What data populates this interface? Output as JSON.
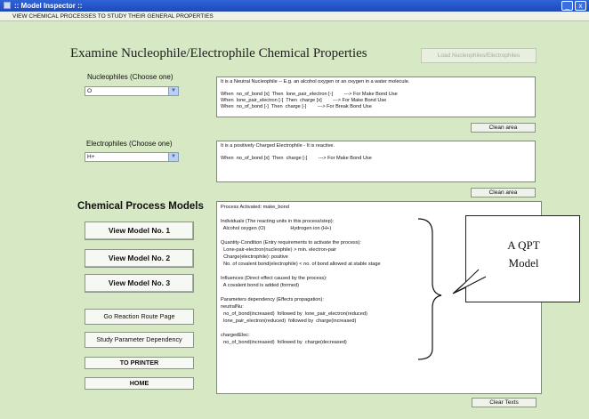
{
  "window": {
    "title": ":: Model Inspector ::",
    "menu_text": "VIEW CHEMICAL PROCESSES TO STUDY THEIR GENERAL PROPERTIES",
    "minimize_glyph": "_",
    "close_glyph": "x"
  },
  "header": {
    "heading": "Examine Nucleophile/Electrophile Chemical Properties",
    "load_button": "Load Nucleophiles/Electrophiles"
  },
  "nucleophiles": {
    "label": "Nucleophiles (Choose one)",
    "selected": "O",
    "lines": [
      "It is a Neutral Nucleophile -- E.g. an alcohol oxygen or an oxygen in a water molecule.",
      "",
      "When  no_of_bond [x]  Then  lone_pair_electron [-]        ---> For Make Bond Use",
      "When  lone_pair_electron [-]  Then  charge [x]        ---> For Make Bond Use",
      "When  no_of_bond [-]  Then  charge [-]        ---> For Break Bond Use"
    ],
    "clean_button": "Clean area"
  },
  "electrophiles": {
    "label": "Electrophiles (Choose one)",
    "selected": "H+",
    "lines": [
      "It is a positively Charged Electrophile - It is reactive.",
      "",
      "When  no_of_bond [x]  Then  charge [-]        ---> For Make Bond Use"
    ],
    "clean_button": "Clean area"
  },
  "models": {
    "title": "Chemical Process Models",
    "buttons": [
      "View Model No. 1",
      "View Model No. 2",
      "View Model No. 3"
    ],
    "route_button": "Go Reaction Route Page",
    "param_button": "Study Parameter Dependency",
    "printer_button": "TO PRINTER",
    "home_button": "HOME"
  },
  "process_text": {
    "lines": [
      "Process Activated: make_bond",
      "",
      "Individuals (The reacting units in this process/step):",
      "  Alcohol oxygen (O)                  Hydrogen ion (H+)",
      "",
      "Quantity-Condition (Entry requirements to activate the process):",
      "  Lone-pair-electron(nucleophile) > min. electron-pair",
      "  Charge(electrophile): positive",
      "  No. of covalent bond(electrophile) < no. of bond allowed at stable stage",
      "",
      "Influences (Direct effect caused by the process):",
      "  A covalent bond is added (formed)",
      "",
      "Parameters dependency (Effects propagation):",
      "neutralNu:",
      "  no_of_bond(increased)  followed by  lone_pair_electron(reduced)",
      "  lone_pair_electron(reduced)  followed by  charge(increased)",
      "",
      "chargedElec:",
      "  no_of_bond(increased)  followed by  charge(decreased)"
    ],
    "clear_button": "Clear Texts"
  },
  "annotation": {
    "line1": "A QPT",
    "line2": "Model"
  }
}
